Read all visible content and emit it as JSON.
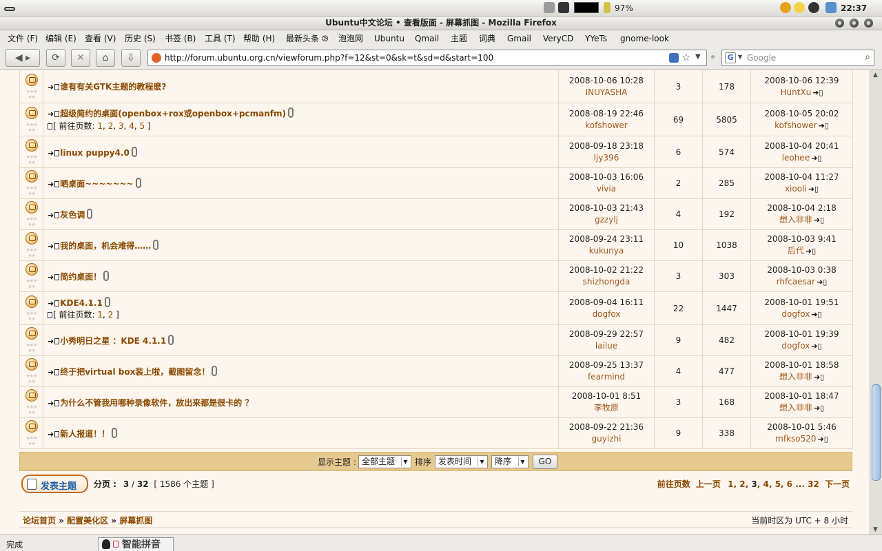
{
  "panel": {
    "battery": "97%",
    "clock": "22:37"
  },
  "window": {
    "title": "Ubuntu中文论坛 • 查看版面 - 屏幕抓图 - Mozilla Firefox"
  },
  "menu": [
    "文件 (F)",
    "编辑 (E)",
    "查看 (V)",
    "历史 (S)",
    "书签 (B)",
    "工具 (T)",
    "帮助 (H)",
    "最新头条 ⧁",
    "泡泡网",
    "Ubuntu",
    "Qmail",
    "主题",
    "词典",
    "Gmail",
    "VeryCD",
    "YYeTs",
    "gnome-look"
  ],
  "nav": {
    "url": "http://forum.ubuntu.org.cn/viewforum.php?f=12&st=0&sk=t&sd=d&start=100",
    "search_placeholder": "Google"
  },
  "topics": [
    {
      "title": "谁有有关GTK主题的教程麽?",
      "clip": false,
      "pages": null,
      "date": "2008-10-06 10:28",
      "author": "INUYASHA",
      "replies": "3",
      "views": "178",
      "last_date": "2008-10-06 12:39",
      "last_author": "HuntXu"
    },
    {
      "title": "超级简约的桌面(openbox+rox或openbox+pcmanfm)",
      "clip": true,
      "pages": [
        "1",
        "2",
        "3",
        "4",
        "5"
      ],
      "date": "2008-08-19 22:46",
      "author": "kofshower",
      "replies": "69",
      "views": "5805",
      "last_date": "2008-10-05 20:02",
      "last_author": "kofshower"
    },
    {
      "title": "linux puppy4.0",
      "clip": true,
      "pages": null,
      "date": "2008-09-18 23:18",
      "author": "ljy396",
      "replies": "6",
      "views": "574",
      "last_date": "2008-10-04 20:41",
      "last_author": "leohee"
    },
    {
      "title": "晒桌面~~~~~~~",
      "clip": true,
      "pages": null,
      "date": "2008-10-03 16:06",
      "author": "vivia",
      "replies": "2",
      "views": "285",
      "last_date": "2008-10-04 11:27",
      "last_author": "xiooli"
    },
    {
      "title": "灰色调",
      "clip": true,
      "pages": null,
      "date": "2008-10-03 21:43",
      "author": "gzzylj",
      "replies": "4",
      "views": "192",
      "last_date": "2008-10-04 2:18",
      "last_author": "想入非非"
    },
    {
      "title": "我的桌面，机会难得……",
      "clip": true,
      "pages": null,
      "date": "2008-09-24 23:11",
      "author": "kukunya",
      "replies": "10",
      "views": "1038",
      "last_date": "2008-10-03 9:41",
      "last_author": "后代"
    },
    {
      "title": "简约桌面！",
      "clip": true,
      "pages": null,
      "date": "2008-10-02 21:22",
      "author": "shizhongda",
      "replies": "3",
      "views": "303",
      "last_date": "2008-10-03 0:38",
      "last_author": "rhfcaesar"
    },
    {
      "title": "KDE4.1.1",
      "clip": true,
      "pages": [
        "1",
        "2"
      ],
      "date": "2008-09-04 16:11",
      "author": "dogfox",
      "replies": "22",
      "views": "1447",
      "last_date": "2008-10-01 19:51",
      "last_author": "dogfox"
    },
    {
      "title": "小秀明日之星 ：KDE 4.1.1",
      "clip": true,
      "pages": null,
      "date": "2008-09-29 22:57",
      "author": "lailue",
      "replies": "9",
      "views": "482",
      "last_date": "2008-10-01 19:39",
      "last_author": "dogfox"
    },
    {
      "title": "终于把virtual box装上啦，截图留念！",
      "clip": true,
      "pages": null,
      "date": "2008-09-25 13:37",
      "author": "fearmind",
      "replies": "4",
      "views": "477",
      "last_date": "2008-10-01 18:58",
      "last_author": "想入非非"
    },
    {
      "title": "为什么不管我用哪种录像软件，放出来都是很卡的 ？",
      "clip": false,
      "pages": null,
      "date": "2008-10-01 8:51",
      "author": "李牧原",
      "replies": "3",
      "views": "168",
      "last_date": "2008-10-01 18:47",
      "last_author": "想入非非"
    },
    {
      "title": "新人报道！！",
      "clip": true,
      "pages": null,
      "date": "2008-09-22 21:36",
      "author": "guyizhi",
      "replies": "9",
      "views": "338",
      "last_date": "2008-10-01 5:46",
      "last_author": "mfkso520"
    }
  ],
  "pages_label": "[ 前往页数: ",
  "filter": {
    "show_label": "显示主题 :",
    "show_value": "全部主题",
    "sort_label": "排序",
    "sort_value": "发表时间",
    "order_value": "降序",
    "go": "GO"
  },
  "pagination": {
    "new_topic": "发表主题",
    "page_label": "分页 :",
    "current": "3",
    "total": "32",
    "topic_count": "[ 1586 个主题 ]",
    "goto_label": "前往页数",
    "prev": "上一页",
    "links": [
      "1",
      "2",
      "3",
      "4",
      "5",
      "6"
    ],
    "ellipsis": "...",
    "last": "32",
    "next": "下一页"
  },
  "breadcrumb": {
    "home": "论坛首页",
    "section": "配置美化区",
    "forum": "屏幕抓图",
    "sep": " » ",
    "timezone": "当前时区为 UTC + 8 小时"
  },
  "status": {
    "text": "完成",
    "ime": "智能拼音"
  }
}
